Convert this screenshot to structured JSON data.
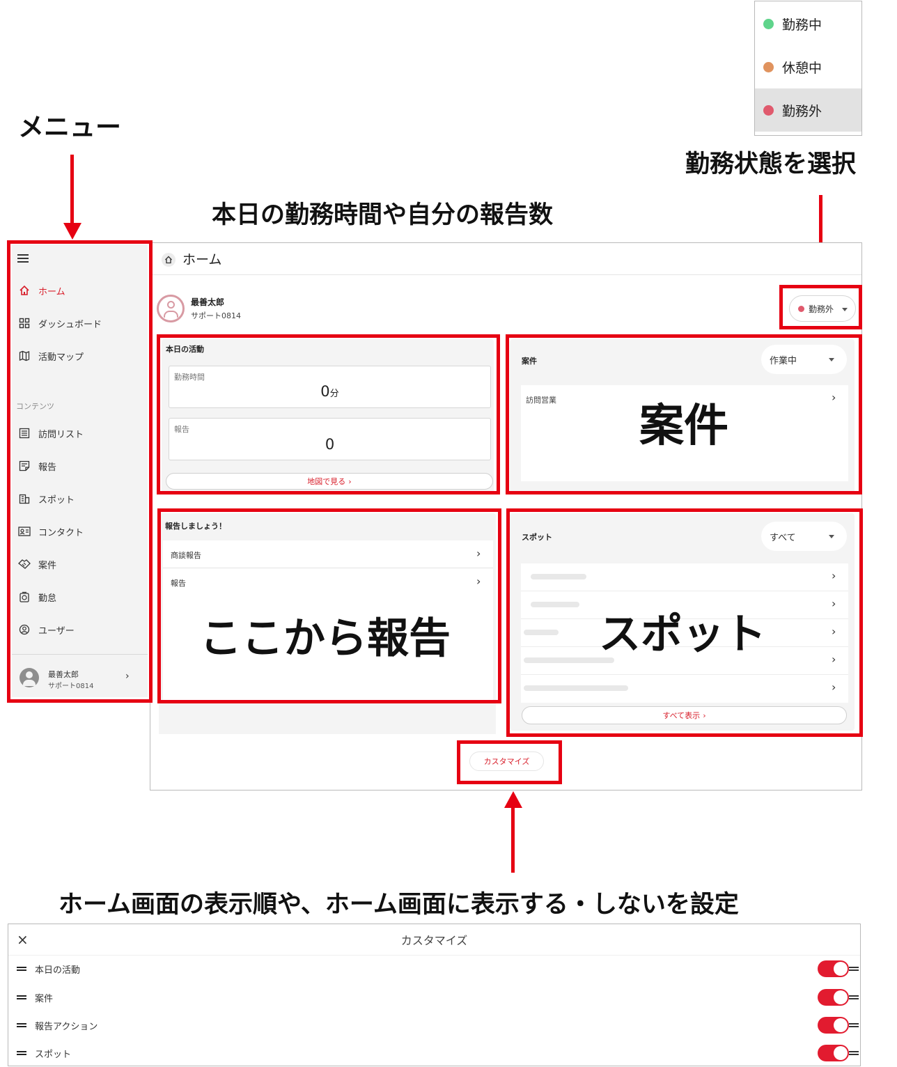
{
  "annotations": {
    "menu": "メニュー",
    "status_select": "勤務状態を選択",
    "today_stats": "本日の勤務時間や自分の報告数",
    "cases_overlay": "案件",
    "report_overlay": "ここから報告",
    "spot_overlay": "スポット",
    "customize_desc": "ホーム画面の表示順や、ホーム画面に表示する・しないを設定"
  },
  "status_menu": {
    "options": [
      {
        "label": "勤務中",
        "color": "#5fd48b"
      },
      {
        "label": "休憩中",
        "color": "#e0935e"
      },
      {
        "label": "勤務外",
        "color": "#e05a6d",
        "selected": true
      }
    ]
  },
  "sidebar": {
    "items": [
      {
        "label": "ホーム",
        "icon": "home-icon",
        "active": true
      },
      {
        "label": "ダッシュボード",
        "icon": "dashboard-icon"
      },
      {
        "label": "活動マップ",
        "icon": "map-icon"
      }
    ],
    "section_label": "コンテンツ",
    "content_items": [
      {
        "label": "訪問リスト",
        "icon": "list-icon"
      },
      {
        "label": "報告",
        "icon": "note-icon"
      },
      {
        "label": "スポット",
        "icon": "building-icon"
      },
      {
        "label": "コンタクト",
        "icon": "contact-card-icon"
      },
      {
        "label": "案件",
        "icon": "handshake-icon"
      },
      {
        "label": "勤怠",
        "icon": "timeclock-icon"
      },
      {
        "label": "ユーザー",
        "icon": "user-circle-icon"
      }
    ],
    "user": {
      "name": "最善太郎",
      "sub": "サポート0814"
    }
  },
  "main": {
    "header_title": "ホーム",
    "user": {
      "name": "最善太郎",
      "sub": "サポート0814"
    },
    "status_value": "勤務外",
    "status_color": "#e05a6d",
    "activity": {
      "title": "本日の活動",
      "work_time_label": "勤務時間",
      "work_time_value": "0",
      "work_time_unit": "分",
      "report_label": "報告",
      "report_value": "0",
      "map_link": "地図で見る"
    },
    "cases": {
      "title": "案件",
      "filter": "作業中",
      "item_label": "訪問営業"
    },
    "report_action": {
      "title": "報告しましょう！",
      "items": [
        "商談報告",
        "報告"
      ]
    },
    "spots": {
      "title": "スポット",
      "filter": "すべて",
      "show_all": "すべて表示"
    },
    "customize_button": "カスタマイズ"
  },
  "customize": {
    "title": "カスタマイズ",
    "rows": [
      "本日の活動",
      "案件",
      "報告アクション",
      "スポット"
    ],
    "accent": "#e21b2f"
  }
}
